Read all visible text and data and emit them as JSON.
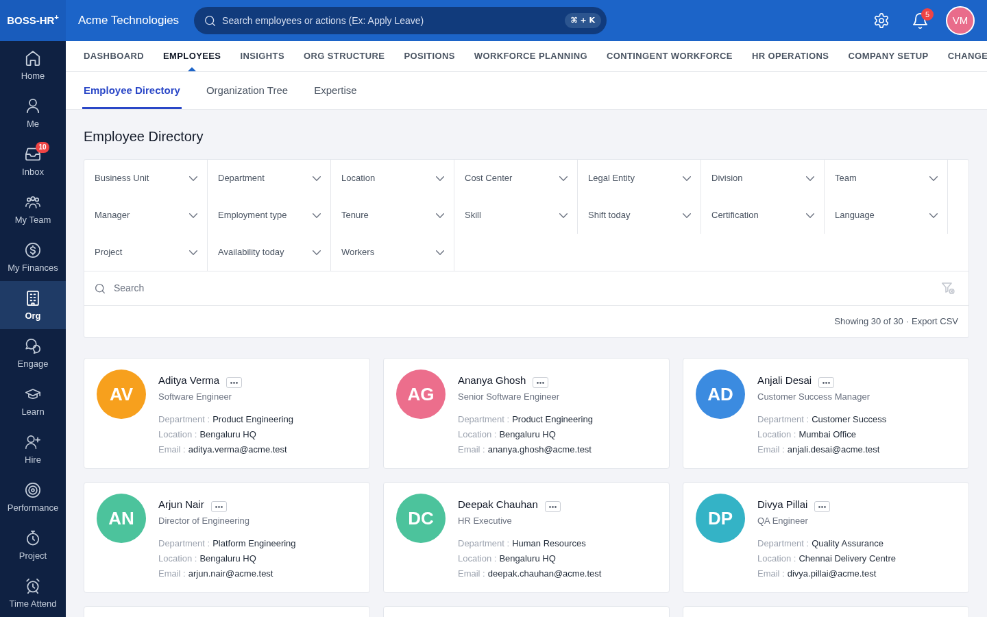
{
  "brand": {
    "logo": "BOSS-HR$^{+}$",
    "company": "Acme Technologies"
  },
  "global_search": {
    "placeholder": "Search employees or actions (Ex: Apply Leave)",
    "shortcut": "⌘ + K"
  },
  "header_actions": {
    "notification_count": "5",
    "user_initials": "VM"
  },
  "sidebar": {
    "items": [
      {
        "label": "Home",
        "selected": false
      },
      {
        "label": "Me",
        "selected": false
      },
      {
        "label": "Inbox",
        "selected": false,
        "badge": "10"
      },
      {
        "label": "My Team",
        "selected": false
      },
      {
        "label": "My Finances",
        "selected": false
      },
      {
        "label": "Org",
        "selected": true
      },
      {
        "label": "Engage",
        "selected": false
      },
      {
        "label": "Learn",
        "selected": false
      },
      {
        "label": "Hire",
        "selected": false
      },
      {
        "label": "Performance",
        "selected": false
      },
      {
        "label": "Project",
        "selected": false
      },
      {
        "label": "Time Attend",
        "selected": false
      }
    ]
  },
  "nav_tabs": [
    {
      "label": "DASHBOARD",
      "selected": false
    },
    {
      "label": "EMPLOYEES",
      "selected": true
    },
    {
      "label": "INSIGHTS",
      "selected": false
    },
    {
      "label": "ORG STRUCTURE",
      "selected": false
    },
    {
      "label": "POSITIONS",
      "selected": false
    },
    {
      "label": "WORKFORCE PLANNING",
      "selected": false
    },
    {
      "label": "CONTINGENT WORKFORCE",
      "selected": false
    },
    {
      "label": "HR OPERATIONS",
      "selected": false
    },
    {
      "label": "COMPANY SETUP",
      "selected": false
    },
    {
      "label": "CHANGE",
      "selected": false
    }
  ],
  "sub_tabs": [
    {
      "label": "Employee Directory",
      "selected": true
    },
    {
      "label": "Organization Tree",
      "selected": false
    },
    {
      "label": "Expertise",
      "selected": false
    }
  ],
  "page_title": "Employee Directory",
  "filters": [
    "Business Unit",
    "Department",
    "Location",
    "Cost Center",
    "Legal Entity",
    "Division",
    "Team",
    "Manager",
    "Employment type",
    "Tenure",
    "Skill",
    "Shift today",
    "Certification",
    "Language",
    "Project",
    "Availability today",
    "Workers"
  ],
  "directory_search": {
    "placeholder": "Search"
  },
  "results": {
    "summary": "Showing 30 of 30",
    "separator": "·",
    "export_label": "Export CSV"
  },
  "employees": [
    {
      "initials": "AV",
      "name": "Aditya Verma",
      "title": "Software Engineer",
      "color": "#f7a01d",
      "details": [
        {
          "label": "Department :",
          "value": "Product Engineering"
        },
        {
          "label": "Location :",
          "value": "Bengaluru HQ"
        },
        {
          "label": "Email :",
          "value": "aditya.verma@acme.test"
        }
      ]
    },
    {
      "initials": "AG",
      "name": "Ananya Ghosh",
      "title": "Senior Software Engineer",
      "color": "#ec6e8c",
      "details": [
        {
          "label": "Department :",
          "value": "Product Engineering"
        },
        {
          "label": "Location :",
          "value": "Bengaluru HQ"
        },
        {
          "label": "Email :",
          "value": "ananya.ghosh@acme.test"
        }
      ]
    },
    {
      "initials": "AD",
      "name": "Anjali Desai",
      "title": "Customer Success Manager",
      "color": "#3b8be0",
      "details": [
        {
          "label": "Department :",
          "value": "Customer Success"
        },
        {
          "label": "Location :",
          "value": "Mumbai Office"
        },
        {
          "label": "Email :",
          "value": "anjali.desai@acme.test"
        }
      ]
    },
    {
      "initials": "AN",
      "name": "Arjun Nair",
      "title": "Director of Engineering",
      "color": "#4cc39c",
      "details": [
        {
          "label": "Department :",
          "value": "Platform Engineering"
        },
        {
          "label": "Location :",
          "value": "Bengaluru HQ"
        },
        {
          "label": "Email :",
          "value": "arjun.nair@acme.test"
        }
      ]
    },
    {
      "initials": "DC",
      "name": "Deepak Chauhan",
      "title": "HR Executive",
      "color": "#4cc39c",
      "details": [
        {
          "label": "Department :",
          "value": "Human Resources"
        },
        {
          "label": "Location :",
          "value": "Bengaluru HQ"
        },
        {
          "label": "Email :",
          "value": "deepak.chauhan@acme.test"
        }
      ]
    },
    {
      "initials": "DP",
      "name": "Divya Pillai",
      "title": "QA Engineer",
      "color": "#34b3c6",
      "details": [
        {
          "label": "Department :",
          "value": "Quality Assurance"
        },
        {
          "label": "Location :",
          "value": "Chennai Delivery Centre"
        },
        {
          "label": "Email :",
          "value": "divya.pillai@acme.test"
        }
      ]
    }
  ]
}
